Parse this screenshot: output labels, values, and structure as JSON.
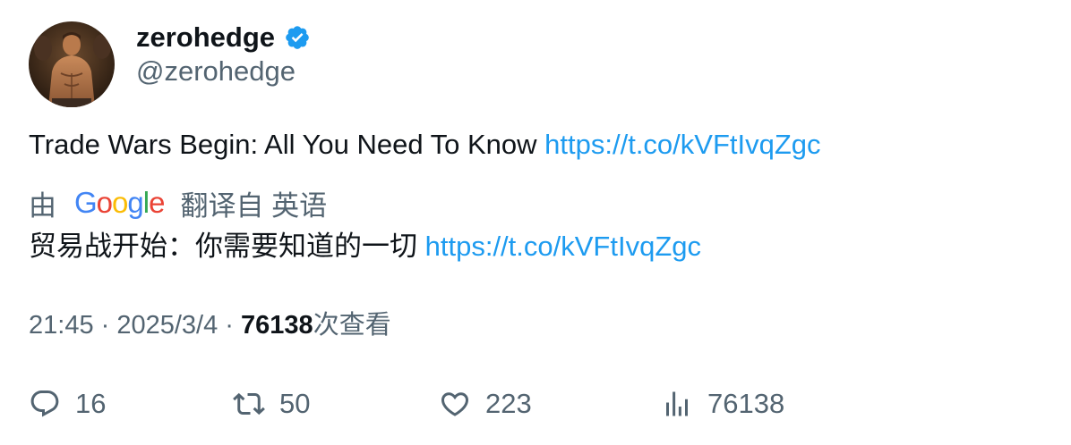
{
  "user": {
    "display_name": "zerohedge",
    "handle": "@zerohedge",
    "verified": true
  },
  "tweet": {
    "text": "Trade Wars Begin: All You Need To Know",
    "link": "https://t.co/kVFtIvqZgc"
  },
  "translation": {
    "prefix": "由",
    "provider": "Google",
    "label": "翻译自 英语",
    "text": "贸易战开始：你需要知道的一切",
    "link": "https://t.co/kVFtIvqZgc"
  },
  "meta": {
    "time": "21:45",
    "separator": " · ",
    "date": "2025/3/4",
    "views_count": "76138",
    "views_suffix": "次查看"
  },
  "actions": {
    "replies": "16",
    "reposts": "50",
    "likes": "223",
    "views": "76138"
  },
  "colors": {
    "accent": "#1d9bf0",
    "secondary_text": "#536471",
    "primary_text": "#0f1419"
  },
  "icons": {
    "verified": "verified-badge-icon",
    "reply": "reply-icon",
    "repost": "repost-icon",
    "like": "heart-icon",
    "views": "analytics-icon"
  }
}
